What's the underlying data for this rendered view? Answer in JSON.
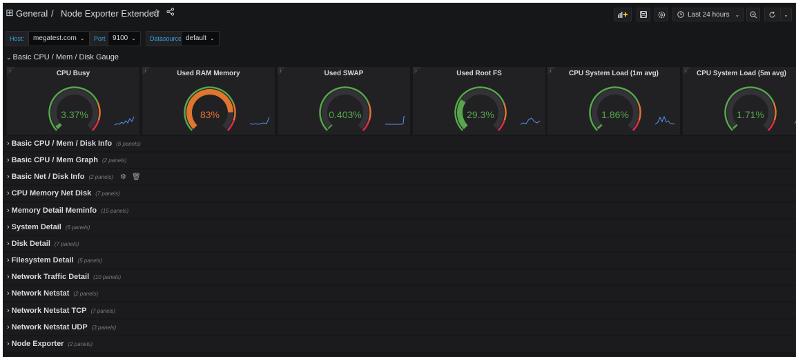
{
  "header": {
    "breadcrumb_folder": "General",
    "breadcrumb_sep": "/",
    "breadcrumb_dashboard": "Node Exporter Extended",
    "time_range": "Last 24 hours"
  },
  "icons": {
    "apps": "apps-grid-icon",
    "star": "star-icon",
    "share": "share-icon",
    "add_panel": "add-panel-icon",
    "save": "save-icon",
    "settings": "gear-icon",
    "clock": "clock-icon",
    "zoom_out": "zoom-out-icon",
    "refresh": "refresh-icon",
    "chevron": "chevron-down-icon",
    "trash": "trash-icon"
  },
  "variables": [
    {
      "label": "Host:",
      "value": "megatest.com"
    },
    {
      "label": "Port",
      "value": "9100"
    },
    {
      "label": "Datasource",
      "value": "default"
    }
  ],
  "open_row": {
    "title": "Basic CPU / Mem / Disk Gauge"
  },
  "gauges": [
    {
      "title": "CPU Busy",
      "value_text": "3.37%",
      "fraction": 0.0337,
      "color": "#56a64b",
      "text_color": "#56a64b"
    },
    {
      "title": "Used RAM Memory",
      "value_text": "83%",
      "fraction": 0.83,
      "color": "#e0752d",
      "text_color": "#e0752d"
    },
    {
      "title": "Used SWAP",
      "value_text": "0.403%",
      "fraction": 0.00403,
      "color": "#56a64b",
      "text_color": "#56a64b"
    },
    {
      "title": "Used Root FS",
      "value_text": "29.3%",
      "fraction": 0.293,
      "color": "#56a64b",
      "text_color": "#56a64b"
    },
    {
      "title": "CPU System Load (1m avg)",
      "value_text": "1.86%",
      "fraction": 0.0186,
      "color": "#56a64b",
      "text_color": "#56a64b"
    },
    {
      "title": "CPU System Load (5m avg)",
      "value_text": "1.71%",
      "fraction": 0.0171,
      "color": "#56a64b",
      "text_color": "#56a64b"
    }
  ],
  "collapsed_rows": [
    {
      "title": "Basic CPU / Mem / Disk Info",
      "count": "(6 panels)"
    },
    {
      "title": "Basic CPU / Mem Graph",
      "count": "(2 panels)"
    },
    {
      "title": "Basic Net / Disk Info",
      "count": "(2 panels)"
    },
    {
      "title": "CPU Memory Net Disk",
      "count": "(7 panels)"
    },
    {
      "title": "Memory Detail Meminfo",
      "count": "(15 panels)"
    },
    {
      "title": "System Detail",
      "count": "(6 panels)"
    },
    {
      "title": "Disk Detail",
      "count": "(7 panels)"
    },
    {
      "title": "Filesystem Detail",
      "count": "(5 panels)"
    },
    {
      "title": "Network Traffic Detail",
      "count": "(10 panels)"
    },
    {
      "title": "Network Netstat",
      "count": "(2 panels)"
    },
    {
      "title": "Network Netstat TCP",
      "count": "(7 panels)"
    },
    {
      "title": "Network Netstat UDP",
      "count": "(3 panels)"
    },
    {
      "title": "Node Exporter",
      "count": "(2 panels)"
    }
  ],
  "colors": {
    "background": "#161719",
    "panel": "#212124",
    "green": "#56a64b",
    "orange": "#e0752d",
    "red": "#e02f44",
    "spark": "#5794f2"
  }
}
